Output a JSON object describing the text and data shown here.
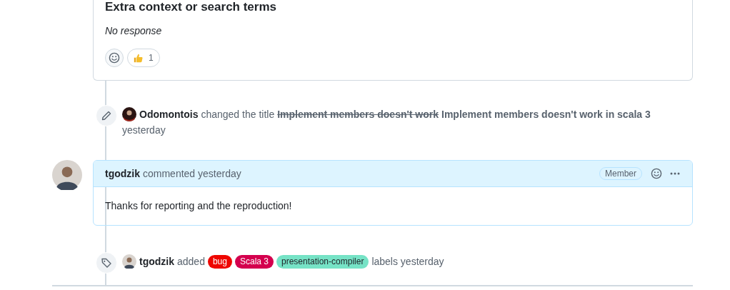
{
  "issue_body": {
    "heading": "Extra context or search terms",
    "answer": "No response",
    "reactions": [
      {
        "kind": "add"
      },
      {
        "kind": "emoji",
        "count": "1"
      }
    ]
  },
  "timeline": [
    {
      "kind": "rename",
      "author": "Odomontois",
      "action": "changed the title",
      "old_title": "Implement members doesn't work",
      "new_title": "Implement members doesn't work in scala 3",
      "time": "yesterday"
    },
    {
      "kind": "comment",
      "author": "tgodzik",
      "action": "commented yesterday",
      "role": "Member",
      "body": "Thanks for reporting and the reproduction!"
    },
    {
      "kind": "labeled",
      "author": "tgodzik",
      "action": "added",
      "labels": [
        {
          "name": "bug",
          "color": "#ee0701"
        },
        {
          "name": "Scala 3",
          "color": "#d4004e"
        },
        {
          "name": "presentation-compiler",
          "color": "#76e3c6"
        }
      ],
      "suffix": "labels yesterday"
    }
  ]
}
